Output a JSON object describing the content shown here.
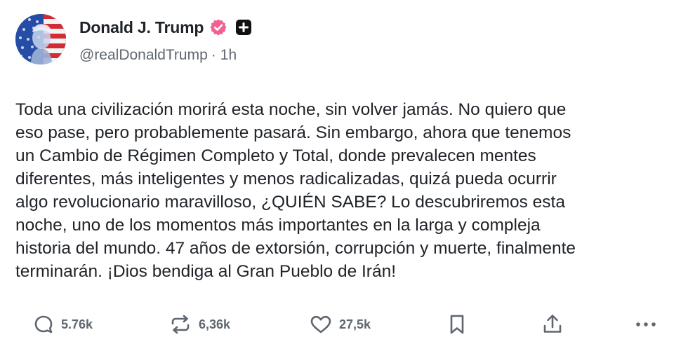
{
  "author": {
    "display_name": "Donald J. Trump",
    "handle": "@realDonaldTrump",
    "separator": "·",
    "timestamp": "1h",
    "verified_color": "#f06292",
    "icons": [
      "verified-badge-icon",
      "plus-badge-icon"
    ]
  },
  "post": {
    "text": "Toda una civilización morirá esta noche, sin volver jamás. No quiero que\neso pase, pero probablemente pasará. Sin embargo, ahora que tenemos\nun Cambio de Régimen Completo y Total, donde prevalecen mentes\ndiferentes, más inteligentes y menos radicalizadas, quizá pueda ocurrir\nalgo revolucionario maravilloso, ¿QUIÉN SABE? Lo descubriremos esta\nnoche, uno de los momentos más importantes en la larga y compleja\nhistoria del mundo. 47 años de extorsión, corrupción y muerte, finalmente\nterminarán. ¡Dios bendiga al Gran Pueblo de Irán!"
  },
  "actions": {
    "replies": "5.76k",
    "reposts": "6,36k",
    "likes": "27,5k",
    "icons": [
      "reply-icon",
      "repost-icon",
      "like-icon",
      "bookmark-icon",
      "share-icon",
      "more-icon"
    ]
  },
  "colors": {
    "text": "#1f2328",
    "muted": "#606770",
    "icon": "#5f6670"
  }
}
